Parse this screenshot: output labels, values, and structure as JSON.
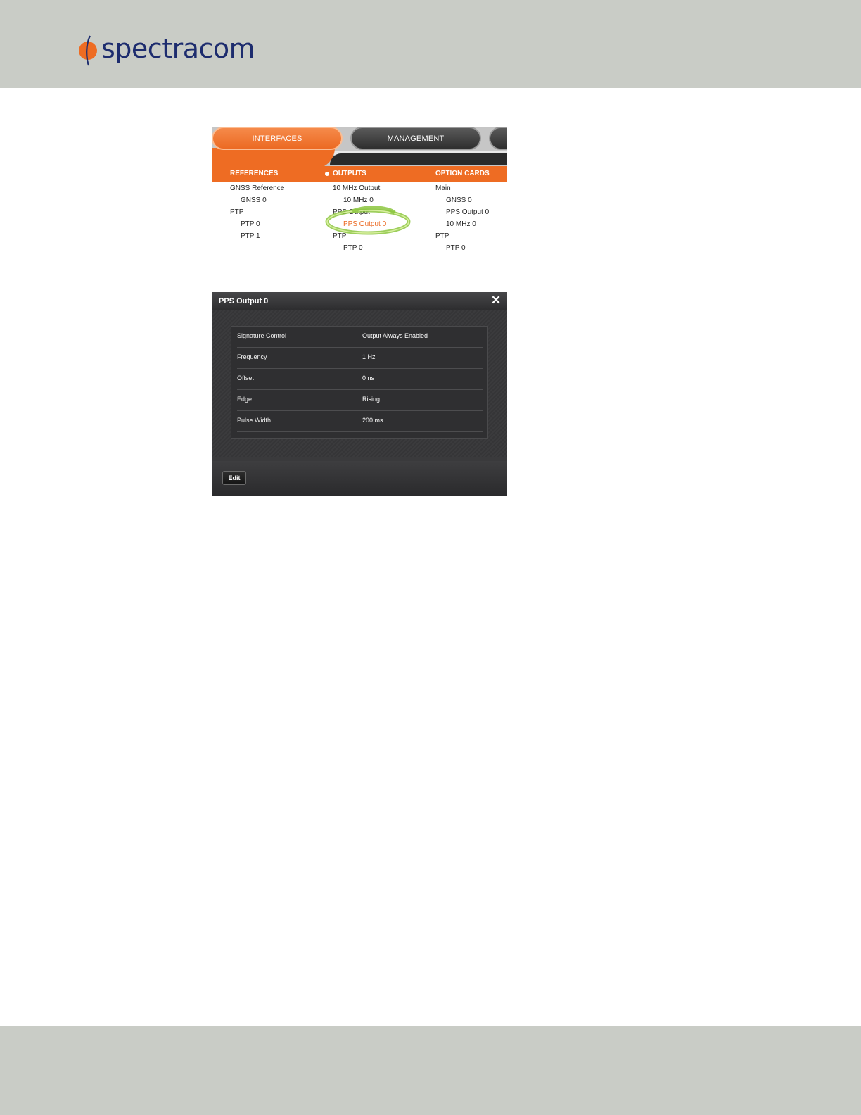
{
  "header": {
    "brand_name": "spectracom",
    "brand_color": "#1d2c6e",
    "accent_color": "#ee6c23"
  },
  "nav": {
    "tabs": [
      {
        "label": "INTERFACES",
        "active": true
      },
      {
        "label": "MANAGEMENT",
        "active": false
      }
    ],
    "columns": {
      "references": {
        "heading": "REFERENCES",
        "items": [
          "GNSS Reference",
          "GNSS 0",
          "PTP",
          "PTP 0",
          "PTP 1"
        ]
      },
      "outputs": {
        "heading": "OUTPUTS",
        "items": [
          "10 MHz Output",
          "10 MHz 0",
          "PPS Output",
          "PPS Output 0",
          "PTP",
          "PTP 0"
        ],
        "active_item": "PPS Output 0"
      },
      "option_cards": {
        "heading": "OPTION CARDS",
        "items": [
          "Main",
          "GNSS 0",
          "PPS Output 0",
          "10 MHz 0",
          "PTP",
          "PTP 0"
        ]
      }
    }
  },
  "dialog": {
    "title": "PPS Output 0",
    "close_icon": "close-icon",
    "rows": [
      {
        "label": "Signature Control",
        "value": "Output Always Enabled"
      },
      {
        "label": "Frequency",
        "value": "1 Hz"
      },
      {
        "label": "Offset",
        "value": "0 ns"
      },
      {
        "label": "Edge",
        "value": "Rising"
      },
      {
        "label": "Pulse Width",
        "value": "200 ms"
      }
    ],
    "edit_label": "Edit"
  }
}
